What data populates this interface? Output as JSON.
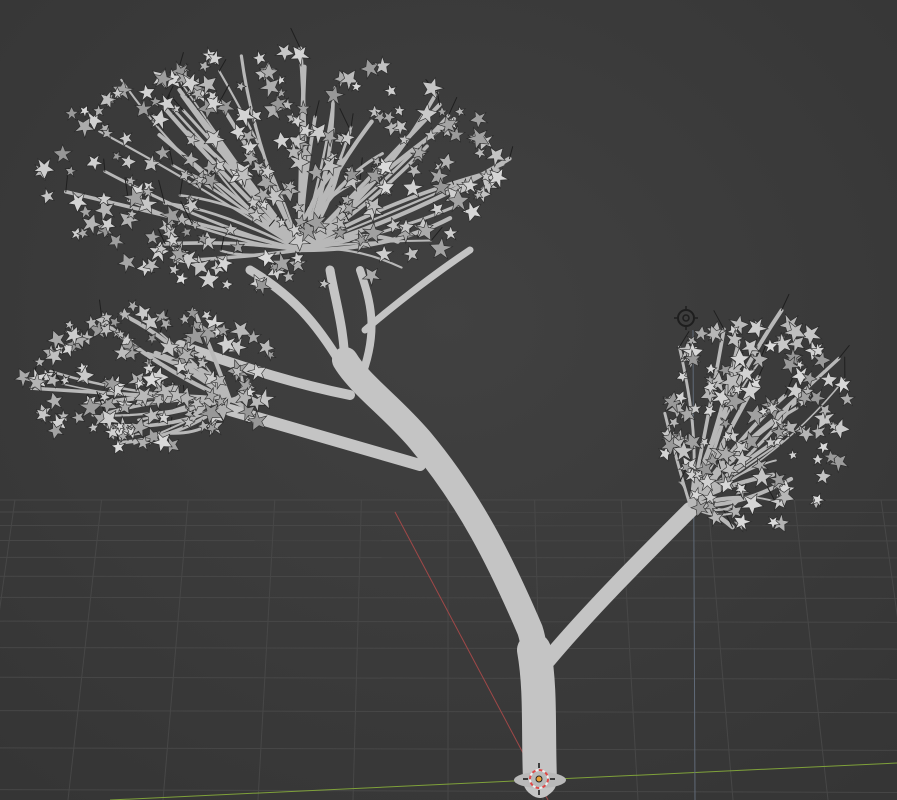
{
  "app": "3D viewport",
  "viewport": {
    "background_color": "#3c3c3c",
    "grid_color": "#4a4a4a",
    "x_axis_color": "#b04a4a",
    "y_axis_color": "#7fa13a",
    "z_axis_color": "#6a7fa0"
  },
  "object": {
    "type": "tree",
    "trunk_color": "#c4c4c4",
    "leaf_color": "#bdbdbd"
  },
  "gizmos": {
    "light": "light-icon",
    "origin": "3d-cursor-icon"
  }
}
